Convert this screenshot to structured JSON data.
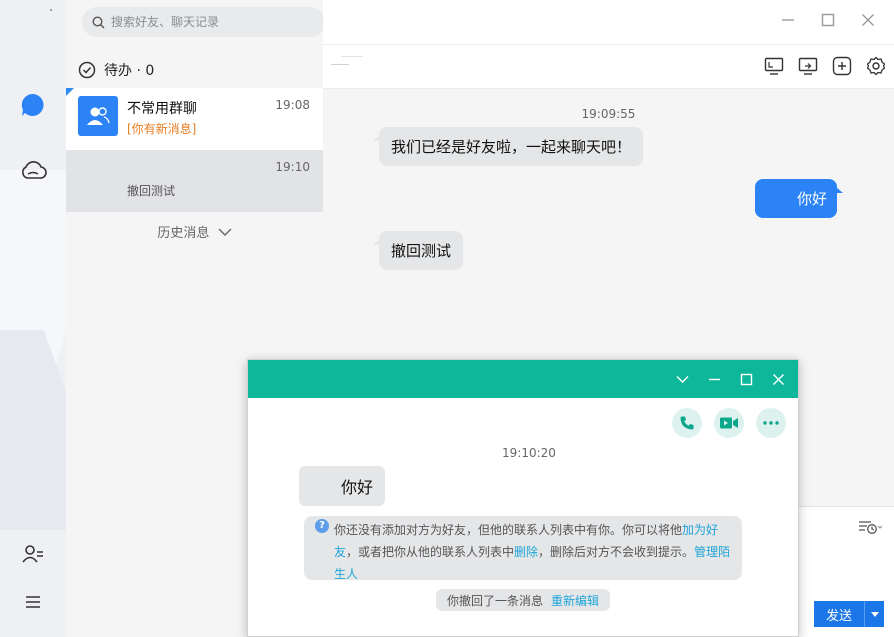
{
  "search": {
    "placeholder": "搜索好友、聊天记录"
  },
  "todo": {
    "label": "待办 · 0"
  },
  "conversations": [
    {
      "name": "不常用群聊",
      "time": "19:08",
      "subtitle": "[你有新消息]"
    },
    {
      "name": "",
      "time": "19:10",
      "subtitle": "撤回测试"
    }
  ],
  "history": {
    "label": "历史消息"
  },
  "chat": {
    "messages": [
      {
        "timestamp": "19:09:55"
      },
      {
        "text": "我们已经是好友啦，一起来聊天吧！",
        "side": "left"
      },
      {
        "text": "你好",
        "side": "right"
      },
      {
        "text": "撤回测试",
        "side": "left"
      }
    ]
  },
  "input": {
    "send_label": "发送"
  },
  "popup": {
    "timestamp": "19:10:20",
    "message": "你好",
    "notice": {
      "part1": "你还没有添加对方为好友，但他的联系人列表中有你。你可以将他",
      "link_add": "加为好友",
      "part2": "，或者把你从他的联系人列表中",
      "link_delete": "删除",
      "part3": "，删除后对方不会收到提示。",
      "link_manage": "管理陌生人"
    },
    "recall": {
      "text": "你撤回了一条消息",
      "link": "重新编辑"
    }
  },
  "colors": {
    "accent": "#2b83f6",
    "popup_title": "#0fb79a",
    "link": "#1ea5d8",
    "new_msg": "#e67e22"
  }
}
